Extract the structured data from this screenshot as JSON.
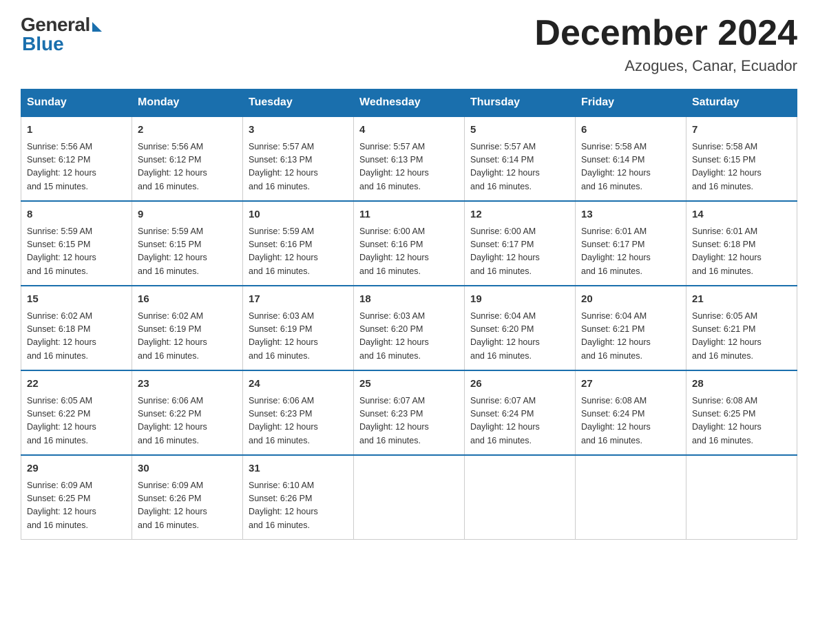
{
  "logo": {
    "general": "General",
    "blue": "Blue"
  },
  "title": {
    "month_year": "December 2024",
    "location": "Azogues, Canar, Ecuador"
  },
  "headers": [
    "Sunday",
    "Monday",
    "Tuesday",
    "Wednesday",
    "Thursday",
    "Friday",
    "Saturday"
  ],
  "weeks": [
    [
      {
        "day": "1",
        "sunrise": "5:56 AM",
        "sunset": "6:12 PM",
        "daylight": "12 hours and 15 minutes."
      },
      {
        "day": "2",
        "sunrise": "5:56 AM",
        "sunset": "6:12 PM",
        "daylight": "12 hours and 16 minutes."
      },
      {
        "day": "3",
        "sunrise": "5:57 AM",
        "sunset": "6:13 PM",
        "daylight": "12 hours and 16 minutes."
      },
      {
        "day": "4",
        "sunrise": "5:57 AM",
        "sunset": "6:13 PM",
        "daylight": "12 hours and 16 minutes."
      },
      {
        "day": "5",
        "sunrise": "5:57 AM",
        "sunset": "6:14 PM",
        "daylight": "12 hours and 16 minutes."
      },
      {
        "day": "6",
        "sunrise": "5:58 AM",
        "sunset": "6:14 PM",
        "daylight": "12 hours and 16 minutes."
      },
      {
        "day": "7",
        "sunrise": "5:58 AM",
        "sunset": "6:15 PM",
        "daylight": "12 hours and 16 minutes."
      }
    ],
    [
      {
        "day": "8",
        "sunrise": "5:59 AM",
        "sunset": "6:15 PM",
        "daylight": "12 hours and 16 minutes."
      },
      {
        "day": "9",
        "sunrise": "5:59 AM",
        "sunset": "6:15 PM",
        "daylight": "12 hours and 16 minutes."
      },
      {
        "day": "10",
        "sunrise": "5:59 AM",
        "sunset": "6:16 PM",
        "daylight": "12 hours and 16 minutes."
      },
      {
        "day": "11",
        "sunrise": "6:00 AM",
        "sunset": "6:16 PM",
        "daylight": "12 hours and 16 minutes."
      },
      {
        "day": "12",
        "sunrise": "6:00 AM",
        "sunset": "6:17 PM",
        "daylight": "12 hours and 16 minutes."
      },
      {
        "day": "13",
        "sunrise": "6:01 AM",
        "sunset": "6:17 PM",
        "daylight": "12 hours and 16 minutes."
      },
      {
        "day": "14",
        "sunrise": "6:01 AM",
        "sunset": "6:18 PM",
        "daylight": "12 hours and 16 minutes."
      }
    ],
    [
      {
        "day": "15",
        "sunrise": "6:02 AM",
        "sunset": "6:18 PM",
        "daylight": "12 hours and 16 minutes."
      },
      {
        "day": "16",
        "sunrise": "6:02 AM",
        "sunset": "6:19 PM",
        "daylight": "12 hours and 16 minutes."
      },
      {
        "day": "17",
        "sunrise": "6:03 AM",
        "sunset": "6:19 PM",
        "daylight": "12 hours and 16 minutes."
      },
      {
        "day": "18",
        "sunrise": "6:03 AM",
        "sunset": "6:20 PM",
        "daylight": "12 hours and 16 minutes."
      },
      {
        "day": "19",
        "sunrise": "6:04 AM",
        "sunset": "6:20 PM",
        "daylight": "12 hours and 16 minutes."
      },
      {
        "day": "20",
        "sunrise": "6:04 AM",
        "sunset": "6:21 PM",
        "daylight": "12 hours and 16 minutes."
      },
      {
        "day": "21",
        "sunrise": "6:05 AM",
        "sunset": "6:21 PM",
        "daylight": "12 hours and 16 minutes."
      }
    ],
    [
      {
        "day": "22",
        "sunrise": "6:05 AM",
        "sunset": "6:22 PM",
        "daylight": "12 hours and 16 minutes."
      },
      {
        "day": "23",
        "sunrise": "6:06 AM",
        "sunset": "6:22 PM",
        "daylight": "12 hours and 16 minutes."
      },
      {
        "day": "24",
        "sunrise": "6:06 AM",
        "sunset": "6:23 PM",
        "daylight": "12 hours and 16 minutes."
      },
      {
        "day": "25",
        "sunrise": "6:07 AM",
        "sunset": "6:23 PM",
        "daylight": "12 hours and 16 minutes."
      },
      {
        "day": "26",
        "sunrise": "6:07 AM",
        "sunset": "6:24 PM",
        "daylight": "12 hours and 16 minutes."
      },
      {
        "day": "27",
        "sunrise": "6:08 AM",
        "sunset": "6:24 PM",
        "daylight": "12 hours and 16 minutes."
      },
      {
        "day": "28",
        "sunrise": "6:08 AM",
        "sunset": "6:25 PM",
        "daylight": "12 hours and 16 minutes."
      }
    ],
    [
      {
        "day": "29",
        "sunrise": "6:09 AM",
        "sunset": "6:25 PM",
        "daylight": "12 hours and 16 minutes."
      },
      {
        "day": "30",
        "sunrise": "6:09 AM",
        "sunset": "6:26 PM",
        "daylight": "12 hours and 16 minutes."
      },
      {
        "day": "31",
        "sunrise": "6:10 AM",
        "sunset": "6:26 PM",
        "daylight": "12 hours and 16 minutes."
      },
      null,
      null,
      null,
      null
    ]
  ],
  "labels": {
    "sunrise": "Sunrise:",
    "sunset": "Sunset:",
    "daylight": "Daylight:"
  }
}
